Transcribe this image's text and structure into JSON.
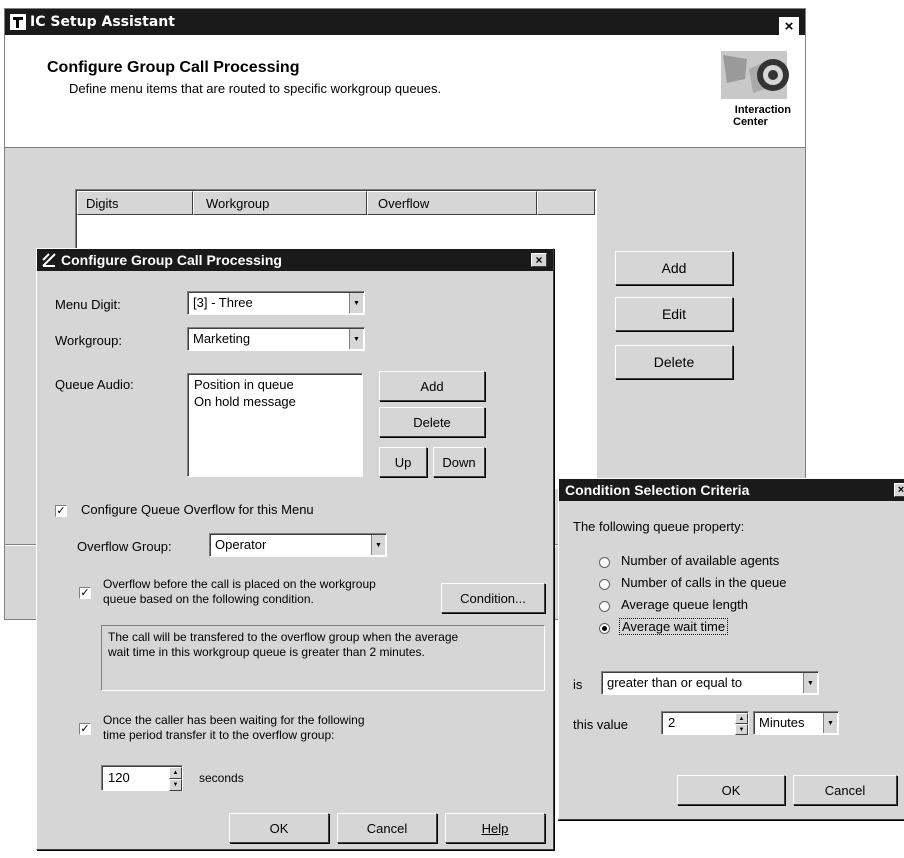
{
  "main_window": {
    "title": "IC Setup Assistant",
    "close_glyph": "×",
    "header_title": "Configure Group Call Processing",
    "header_subtitle": "Define menu items that are routed to specific workgroup queues.",
    "logo_text_line1": "Interaction",
    "logo_text_line2": "Center",
    "table_headers": [
      "Digits",
      "Workgroup",
      "Overflow"
    ],
    "buttons": {
      "add": "Add",
      "edit": "Edit",
      "delete": "Delete"
    }
  },
  "dialog": {
    "title": "Configure Group Call Processing",
    "close_glyph": "×",
    "menu_digit_label": "Menu Digit:",
    "menu_digit_value": "[3] - Three",
    "workgroup_label": "Workgroup:",
    "workgroup_value": "Marketing",
    "queue_audio_label": "Queue Audio:",
    "queue_audio_items": [
      "Position in queue",
      "On hold message"
    ],
    "queue_audio_buttons": {
      "add": "Add",
      "delete": "Delete",
      "up": "Up",
      "down": "Down"
    },
    "configure_overflow_label": "Configure Queue Overflow for this Menu",
    "configure_overflow_checked": true,
    "overflow_group_label": "Overflow Group:",
    "overflow_group_value": "Operator",
    "overflow_before_label_line1": "Overflow before the call is placed on the workgroup",
    "overflow_before_label_line2": "queue based on the following condition.",
    "overflow_before_checked": true,
    "condition_button": "Condition...",
    "condition_description_line1": "The call will be transfered to the overflow group when the average",
    "condition_description_line2": "wait time in this workgroup queue is greater than 2 minutes.",
    "once_waiting_label_line1": "Once the caller has been waiting for the following",
    "once_waiting_label_line2": "time period transfer it to the overflow group:",
    "once_waiting_checked": true,
    "wait_seconds_value": "120",
    "seconds_label": "seconds",
    "buttons": {
      "ok": "OK",
      "cancel": "Cancel",
      "help": "Help"
    }
  },
  "condition_dialog": {
    "title": "Condition Selection Criteria",
    "close_glyph": "×",
    "prompt": "The following queue property:",
    "options": [
      {
        "label": "Number of available agents",
        "selected": false
      },
      {
        "label": "Number of calls in the queue",
        "selected": false
      },
      {
        "label": "Average queue length",
        "selected": false
      },
      {
        "label": "Average wait time",
        "selected": true
      }
    ],
    "is_label": "is",
    "comparison_value": "greater than or equal to",
    "this_value_label": "this value",
    "value": "2",
    "unit_value": "Minutes",
    "buttons": {
      "ok": "OK",
      "cancel": "Cancel"
    }
  },
  "colors": {
    "titlebar": "#1a1a1a",
    "window_bg": "#d6d6d6",
    "header_bg": "#ffffff"
  }
}
